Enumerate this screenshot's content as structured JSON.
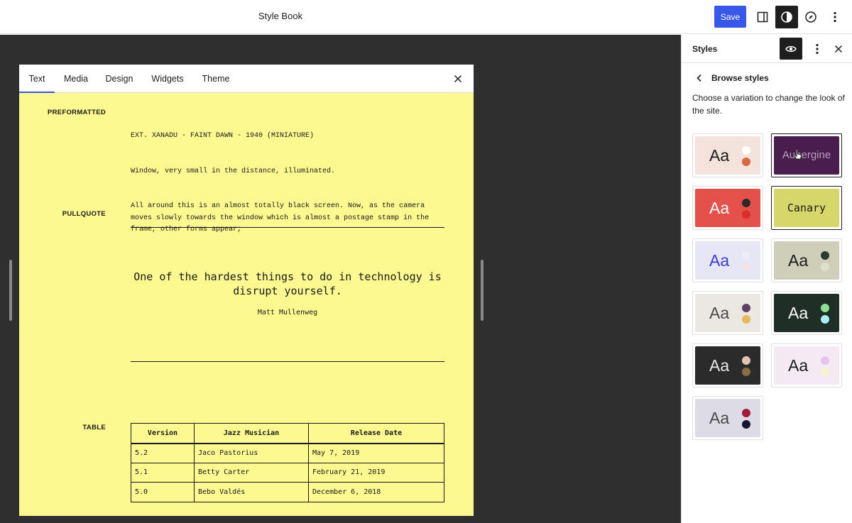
{
  "topbar": {
    "title": "Style Book",
    "save_label": "Save",
    "icons": [
      "sidebar-toggle-icon",
      "styles-contrast-icon",
      "compass-icon",
      "more-vertical-icon"
    ]
  },
  "stylebook": {
    "tabs": [
      {
        "label": "Text",
        "active": true
      },
      {
        "label": "Media",
        "active": false
      },
      {
        "label": "Design",
        "active": false
      },
      {
        "label": "Widgets",
        "active": false
      },
      {
        "label": "Theme",
        "active": false
      }
    ],
    "preformatted": {
      "label": "PREFORMATTED",
      "lines": [
        "EXT. XANADU - FAINT DAWN - 1940 (MINIATURE)",
        "Window, very small in the distance, illuminated.",
        "All around this is an almost totally black screen. Now, as the camera moves slowly towards the window which is almost a postage stamp in the frame, other forms appear;"
      ]
    },
    "pullquote": {
      "label": "PULLQUOTE",
      "text": "One of the hardest things to do in technology is disrupt yourself.",
      "citation": "Matt Mullenweg"
    },
    "table": {
      "label": "TABLE",
      "headers": [
        "Version",
        "Jazz Musician",
        "Release Date"
      ],
      "rows": [
        [
          "5.2",
          "Jaco Pastorius",
          "May 7, 2019"
        ],
        [
          "5.1",
          "Betty Carter",
          "February 21, 2019"
        ],
        [
          "5.0",
          "Bebo Valdés",
          "December 6, 2018"
        ]
      ]
    },
    "background_color": "#fbf98f"
  },
  "sidebar": {
    "title": "Styles",
    "subtitle": "Browse styles",
    "description": "Choose a variation to change the look of the site.",
    "variations": [
      {
        "text": "Aa",
        "bg": "#f3e3dc",
        "fg": "#1a1a1a",
        "dots": [
          "#ffffff",
          "#d9693f"
        ],
        "selected": false
      },
      {
        "text": "Aubergine",
        "bg": "#4a1d4f",
        "fg": "#b8a3bd",
        "dots": [],
        "selected": true
      },
      {
        "text": "Aa",
        "bg": "#e4504a",
        "fg": "#ffffff",
        "dots": [
          "#2b2b2b",
          "#d92f2a"
        ],
        "selected": false
      },
      {
        "text": "Canary",
        "bg": "#d6d66a",
        "fg": "#1a1a1a",
        "dots": [],
        "selected": true
      },
      {
        "text": "Aa",
        "bg": "#e6e6f7",
        "fg": "#3b3bd4",
        "dots": [
          "#ededf7",
          "#f2e3e6"
        ],
        "selected": false
      },
      {
        "text": "Aa",
        "bg": "#cfcfb9",
        "fg": "#1a1a1a",
        "dots": [
          "#2b3b2e",
          "#e0dfcc"
        ],
        "selected": false
      },
      {
        "text": "Aa",
        "bg": "#ebe7e3",
        "fg": "#4a4a4a",
        "dots": [
          "#5b4463",
          "#e8b85c"
        ],
        "selected": false
      },
      {
        "text": "Aa",
        "bg": "#1f2e27",
        "fg": "#ffffff",
        "dots": [
          "#8de08f",
          "#a6f2f2"
        ],
        "selected": false
      },
      {
        "text": "Aa",
        "bg": "#2b2b2b",
        "fg": "#e8e8e8",
        "dots": [
          "#e3c4b4",
          "#8a6c42"
        ],
        "selected": false
      },
      {
        "text": "Aa",
        "bg": "#f4eaf4",
        "fg": "#1a1a1a",
        "dots": [
          "#e7c4ee",
          "#f5f3cc"
        ],
        "selected": false
      },
      {
        "text": "Aa",
        "bg": "#dcdbe6",
        "fg": "#4a4a4a",
        "dots": [
          "#a11c3a",
          "#1c1433"
        ],
        "selected": false
      }
    ]
  },
  "colors": {
    "accent": "#3858e9",
    "canvas": "#2f2f2f"
  }
}
